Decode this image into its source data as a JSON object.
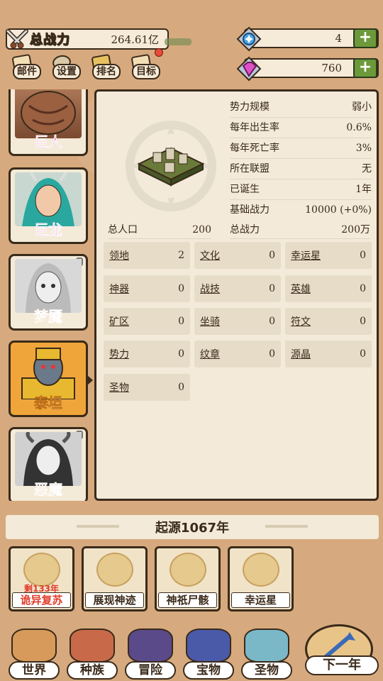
{
  "top_bar": {
    "power_label": "总战力",
    "power_value": "264.61亿",
    "buttons": [
      {
        "name": "mail",
        "label": "邮件"
      },
      {
        "name": "settings",
        "label": "设置"
      },
      {
        "name": "rank",
        "label": "排名"
      },
      {
        "name": "goal",
        "label": "目标"
      }
    ],
    "crystal_value": "4",
    "gem_value": "760",
    "plus": "+"
  },
  "races": [
    {
      "name": "巨人",
      "state": "normal"
    },
    {
      "name": "巨龙",
      "state": "normal"
    },
    {
      "name": "梦魇",
      "state": "locked"
    },
    {
      "name": "泰坦",
      "state": "active"
    },
    {
      "name": "恶魔",
      "state": "locked"
    }
  ],
  "info": [
    {
      "label": "势力规模",
      "value": "弱小"
    },
    {
      "label": "每年出生率",
      "value": "0.6%"
    },
    {
      "label": "每年死亡率",
      "value": "3%"
    },
    {
      "label": "所在联盟",
      "value": "无"
    },
    {
      "label": "已诞生",
      "value": "1年"
    },
    {
      "label": "基础战力",
      "value": "10000 (+0%)"
    }
  ],
  "summary": {
    "population_label": "总人口",
    "population_value": "200",
    "total_power_label": "总战力",
    "total_power_value": "200万"
  },
  "stats": [
    {
      "label": "领地",
      "value": "2"
    },
    {
      "label": "文化",
      "value": "0"
    },
    {
      "label": "幸运星",
      "value": "0"
    },
    {
      "label": "神器",
      "value": "0"
    },
    {
      "label": "战技",
      "value": "0"
    },
    {
      "label": "英雄",
      "value": "0"
    },
    {
      "label": "矿区",
      "value": "0"
    },
    {
      "label": "坐骑",
      "value": "0"
    },
    {
      "label": "符文",
      "value": "0"
    },
    {
      "label": "势力",
      "value": "0"
    },
    {
      "label": "纹章",
      "value": "0"
    },
    {
      "label": "源晶",
      "value": "0"
    },
    {
      "label": "圣物",
      "value": "0"
    }
  ],
  "epoch": "起源1067年",
  "actions": [
    {
      "label": "诡异复苏",
      "sub": "剩133年",
      "red": true
    },
    {
      "label": "展现神迹",
      "sub": "",
      "red": false
    },
    {
      "label": "神祇尸骸",
      "sub": "",
      "red": false
    },
    {
      "label": "幸运星",
      "sub": "",
      "red": false
    }
  ],
  "nav": [
    {
      "label": "世界"
    },
    {
      "label": "种族"
    },
    {
      "label": "冒险"
    },
    {
      "label": "宝物"
    },
    {
      "label": "圣物"
    }
  ],
  "next_label": "下一年",
  "colors": {
    "background": "#d6aa7e",
    "panel": "#f3ead9",
    "active_card": "#f0a53a",
    "race_name": "#e94ba6",
    "plus_green": "#6c9a3a",
    "red_text": "#e23a2a"
  }
}
